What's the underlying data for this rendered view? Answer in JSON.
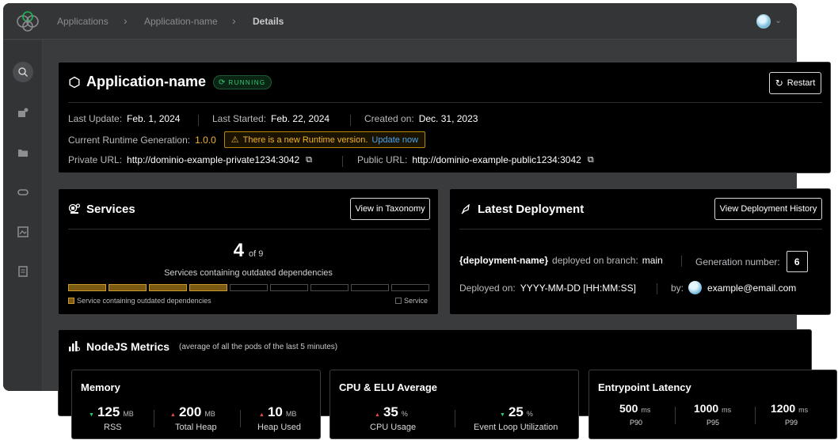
{
  "breadcrumb": {
    "items": [
      "Applications",
      "Application-name",
      "Details"
    ]
  },
  "app": {
    "name": "Application-name",
    "status": "RUNNING",
    "restart_label": "Restart",
    "last_update_label": "Last Update:",
    "last_update": "Feb. 1, 2024",
    "last_started_label": "Last Started:",
    "last_started": "Feb. 22, 2024",
    "created_label": "Created on:",
    "created": "Dec. 31, 2023",
    "runtime_label": "Current Runtime Generation:",
    "runtime_version": "1.0.0",
    "runtime_warning": "There is a new Runtime version.",
    "update_link": "Update now",
    "private_url_label": "Private URL:",
    "private_url": "http://dominio-example-private1234:3042",
    "public_url_label": "Public URL:",
    "public_url": "http://dominio-example-public1234:3042"
  },
  "services": {
    "title": "Services",
    "button": "View in Taxonomy",
    "count": "4",
    "of_total": "of 9",
    "outdated": 4,
    "total": 9,
    "caption": "Services containing outdated dependencies",
    "legend_outdated": "Service containing outdated dependencies",
    "legend_service": "Service"
  },
  "deployment": {
    "title": "Latest Deployment",
    "button": "View Deployment History",
    "name": "{deployment-name}",
    "deployed_on_branch_label": "deployed on branch:",
    "branch": "main",
    "generation_label": "Generation number:",
    "generation": "6",
    "deployed_on_label": "Deployed on:",
    "deployed_on": "YYYY-MM-DD [HH:MM:SS]",
    "by_label": "by:",
    "email": "example@email.com"
  },
  "metrics": {
    "title": "NodeJS Metrics",
    "subtitle": "(average of all the pods of the last 5 minutes)",
    "memory": {
      "title": "Memory",
      "items": [
        {
          "value": "125",
          "unit": "MB",
          "label": "RSS",
          "trend": "down"
        },
        {
          "value": "200",
          "unit": "MB",
          "label": "Total Heap",
          "trend": "up"
        },
        {
          "value": "10",
          "unit": "MB",
          "label": "Heap Used",
          "trend": "up"
        }
      ]
    },
    "cpu": {
      "title": "CPU & ELU Average",
      "items": [
        {
          "value": "35",
          "unit": "%",
          "label": "CPU Usage",
          "trend": "up"
        },
        {
          "value": "25",
          "unit": "%",
          "label": "Event Loop Utilization",
          "trend": "down"
        }
      ]
    },
    "latency": {
      "title": "Entrypoint Latency",
      "items": [
        {
          "value": "500",
          "unit": "ms",
          "label": "P90"
        },
        {
          "value": "1000",
          "unit": "ms",
          "label": "P95"
        },
        {
          "value": "1200",
          "unit": "ms",
          "label": "P99"
        }
      ]
    }
  },
  "colors": {
    "accent_green": "#2ecc71",
    "warning": "#f0b429",
    "link": "#4aa3f0",
    "trend_up": "#e74c3c"
  }
}
